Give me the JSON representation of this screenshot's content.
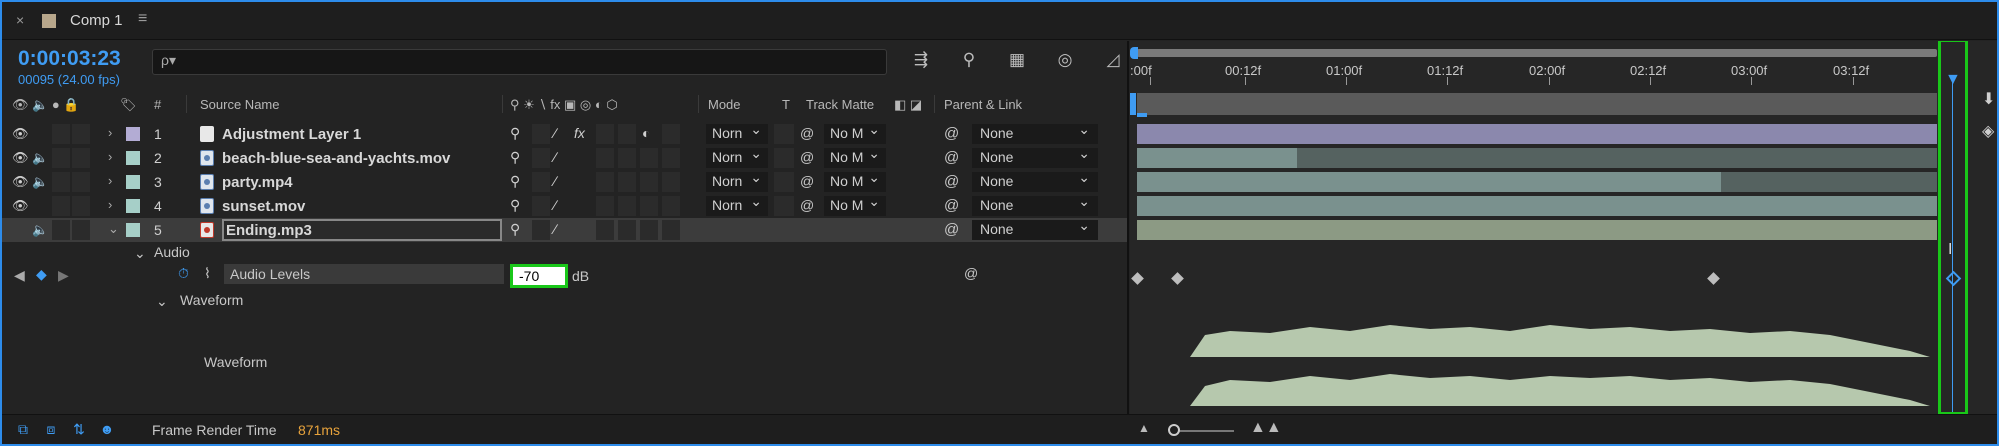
{
  "tab": {
    "close": "×",
    "title": "Comp 1",
    "menu": "≡"
  },
  "header": {
    "timecode": "0:00:03:23",
    "framecount": "00095 (24.00 fps)",
    "search_icon": "ρ▾",
    "tool_icons": [
      "comp-mini-flowchart-icon",
      "draft-3d-icon",
      "frame-blending-icon",
      "motion-blur-icon",
      "graph-editor-icon"
    ]
  },
  "columns": {
    "av_icons": "👁 🔈 ● 🔒",
    "label_icon": "🏷",
    "num": "#",
    "source_name": "Source Name",
    "switch_icons": "⚲ ☀ ∖ fx ▣ ◎ ◐ ⬡",
    "mode": "Mode",
    "t": "T",
    "track_matte": "Track Matte",
    "matte_icons": "◧ ◪",
    "parent": "Parent & Link"
  },
  "layers": [
    {
      "num": "1",
      "name": "Adjustment Layer 1",
      "label": "#b3acd4",
      "mode": "Norn",
      "matte": "No M",
      "parent": "None",
      "video": true,
      "audio": false,
      "type": "solid"
    },
    {
      "num": "2",
      "name": "beach-blue-sea-and-yachts.mov",
      "label": "#a6cfc8",
      "mode": "Norn",
      "matte": "No M",
      "parent": "None",
      "video": true,
      "audio": true,
      "type": "video"
    },
    {
      "num": "3",
      "name": "party.mp4",
      "label": "#a6cfc8",
      "mode": "Norn",
      "matte": "No M",
      "parent": "None",
      "video": true,
      "audio": true,
      "type": "video"
    },
    {
      "num": "4",
      "name": "sunset.mov",
      "label": "#a6cfc8",
      "mode": "Norn",
      "matte": "No M",
      "parent": "None",
      "video": true,
      "audio": false,
      "type": "video"
    },
    {
      "num": "5",
      "name": "Ending.mp3",
      "label": "#a6cfc8",
      "parent": "None",
      "video": false,
      "audio": true,
      "type": "audio"
    }
  ],
  "audio_group": {
    "label": "Audio"
  },
  "audio_levels": {
    "name": "Audio Levels",
    "value": "-70",
    "unit": "dB"
  },
  "waveform": {
    "group_label": "Waveform",
    "row_label": "Waveform"
  },
  "timeline": {
    "ruler": [
      ":00f",
      "00:12f",
      "01:00f",
      "01:12f",
      "02:00f",
      "02:12f",
      "03:00f",
      "03:12f"
    ],
    "bars": [
      {
        "color": "#8b88ad",
        "start": 0.0,
        "end": 1.0
      },
      {
        "color": "#7a918e",
        "start": 0.0,
        "end": 0.2,
        "rest": "#556260"
      },
      {
        "color": "#7a918e",
        "start": 0.0,
        "end": 0.73,
        "rest": "#556260"
      },
      {
        "color": "#7a918e",
        "start": 0.0,
        "end": 1.0
      },
      {
        "color": "#8c9a84",
        "start": 0.0,
        "end": 1.0
      }
    ],
    "keyframes": [
      0.0,
      0.05,
      0.72
    ]
  },
  "bottom": {
    "icons": [
      "comp-nav-icon",
      "layer-switches-icon",
      "transfer-controls-icon",
      "render-time-icon"
    ],
    "frame_render_label": "Frame Render Time",
    "frame_render_value": "871ms",
    "zoom_small": "▲",
    "zoom_big": "▲▲"
  },
  "colors": {
    "accent": "#3f9cf3",
    "highlight": "#19c719",
    "render_time": "#e8a33c"
  }
}
